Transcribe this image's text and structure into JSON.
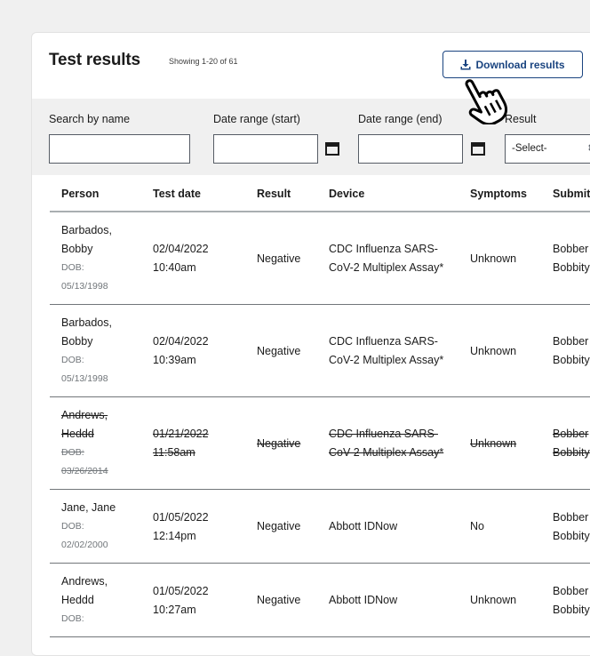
{
  "header": {
    "title": "Test results",
    "showing": "Showing 1-20 of 61",
    "download_label": "Download results"
  },
  "filters": {
    "search_label": "Search by name",
    "search_value": "",
    "date_start_label": "Date range (start)",
    "date_start_value": "",
    "date_end_label": "Date range (end)",
    "date_end_value": "",
    "result_label": "Result",
    "result_selected": "-Select-"
  },
  "table": {
    "columns": [
      "Person",
      "Test date",
      "Result",
      "Device",
      "Symptoms",
      "Submit"
    ],
    "rows": [
      {
        "name": "Barbados, Bobby",
        "dob_label": "DOB:",
        "dob": "05/13/1998",
        "date": "02/04/2022",
        "time": "10:40am",
        "result": "Negative",
        "device": "CDC Influenza SARS-CoV-2 Multiplex Assay*",
        "symptoms": "Unknown",
        "submitter_1": "Bobber",
        "submitter_2": "Bobbity",
        "removed": false
      },
      {
        "name": "Barbados, Bobby",
        "dob_label": "DOB:",
        "dob": "05/13/1998",
        "date": "02/04/2022",
        "time": "10:39am",
        "result": "Negative",
        "device": "CDC Influenza SARS-CoV-2 Multiplex Assay*",
        "symptoms": "Unknown",
        "submitter_1": "Bobber",
        "submitter_2": "Bobbity",
        "removed": false
      },
      {
        "name": "Andrews, Heddd",
        "dob_label": "DOB:",
        "dob": "03/26/2014",
        "date": "01/21/2022",
        "time": "11:58am",
        "result": "Negative",
        "device": "CDC Influenza SARS-CoV-2 Multiplex Assay*",
        "symptoms": "Unknown",
        "submitter_1": "Bobber",
        "submitter_2": "Bobbity",
        "removed": true
      },
      {
        "name": "Jane, Jane",
        "dob_label": "DOB:",
        "dob": "02/02/2000",
        "date": "01/05/2022",
        "time": "12:14pm",
        "result": "Negative",
        "device": "Abbott IDNow",
        "symptoms": "No",
        "submitter_1": "Bobber",
        "submitter_2": "Bobbity",
        "removed": false
      },
      {
        "name": "Andrews, Heddd",
        "dob_label": "DOB:",
        "dob": "",
        "date": "01/05/2022",
        "time": "10:27am",
        "result": "Negative",
        "device": "Abbott IDNow",
        "symptoms": "Unknown",
        "submitter_1": "Bobber",
        "submitter_2": "Bobbity",
        "removed": false
      }
    ]
  },
  "colors": {
    "primary": "#1a4480",
    "background": "#f0f0f0"
  }
}
